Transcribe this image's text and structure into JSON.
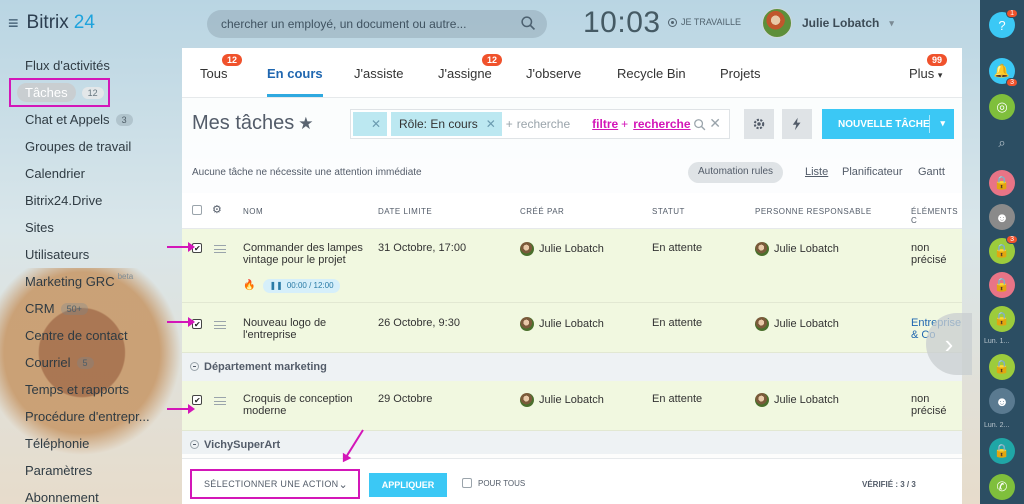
{
  "colors": {
    "accent": "#3bc8f5",
    "highlight": "#d316b8",
    "badge": "#f0522c",
    "row_bg": "#f1f8e0"
  },
  "header": {
    "brand": "Bitrix",
    "brand_num": "24",
    "search_placeholder": "chercher un employé, un document ou autre...",
    "clock": "10:03",
    "work_status": "JE TRAVAILLE",
    "user_name": "Julie Lobatch"
  },
  "sidebar": {
    "items": [
      {
        "label": "Flux d'activités"
      },
      {
        "label": "Tâches",
        "count": "12"
      },
      {
        "label": "Chat et Appels",
        "count": "3"
      },
      {
        "label": "Groupes de travail"
      },
      {
        "label": "Calendrier"
      },
      {
        "label": "Bitrix24.Drive"
      },
      {
        "label": "Sites"
      },
      {
        "label": "Utilisateurs"
      },
      {
        "label": "Marketing GRC",
        "beta": "beta"
      },
      {
        "label": "CRM",
        "count": "50+"
      },
      {
        "label": "Centre de contact"
      },
      {
        "label": "Courriel",
        "count": "5"
      },
      {
        "label": "Temps et rapports"
      },
      {
        "label": "Procédure d'entrepr..."
      },
      {
        "label": "Téléphonie"
      },
      {
        "label": "Paramètres"
      },
      {
        "label": "Abonnement"
      }
    ]
  },
  "tabs": [
    {
      "label": "Tous",
      "badge": "12"
    },
    {
      "label": "En cours"
    },
    {
      "label": "J'assiste"
    },
    {
      "label": "J'assigne",
      "badge": "12"
    },
    {
      "label": "J'observe"
    },
    {
      "label": "Recycle Bin"
    },
    {
      "label": "Projets"
    },
    {
      "label": "Plus",
      "badge": "99"
    }
  ],
  "toolbar": {
    "title": "Mes tâches",
    "filter_chip": "Rôle: En cours",
    "filter_placeholder": "recherche",
    "filter_link1": "filtre",
    "filter_link2": "recherche",
    "new_task": "NOUVELLE TÂCHE"
  },
  "subbar": {
    "attention": "Aucune tâche ne nécessite une attention immédiate",
    "automation": "Automation rules",
    "views": [
      "Liste",
      "Planificateur",
      "Gantt"
    ]
  },
  "grid": {
    "headers": [
      "NOM",
      "DATE LIMITE",
      "CRÉÉ PAR",
      "STATUT",
      "PERSONNE RESPONSABLE",
      "ÉLÉMENTS C"
    ],
    "rows": [
      {
        "name": "Commander des lampes vintage pour le projet",
        "deadline": "31 Octobre, 17:00",
        "creator": "Julie Lobatch",
        "status": "En attente",
        "responsible": "Julie Lobatch",
        "elements": "non précisé",
        "timer": "00:00 / 12:00"
      },
      {
        "name": "Nouveau logo de l'entreprise",
        "deadline": "26 Octobre, 9:30",
        "creator": "Julie Lobatch",
        "status": "En attente",
        "responsible": "Julie Lobatch",
        "elements": "Entreprise: & Co"
      },
      {
        "name": "Croquis de conception moderne",
        "deadline": "29 Octobre",
        "creator": "Julie Lobatch",
        "status": "En attente",
        "responsible": "Julie Lobatch",
        "elements": "non précisé"
      }
    ],
    "groups": [
      "Département marketing",
      "VichySuperArt"
    ]
  },
  "bottom": {
    "action_select": "SÉLECTIONNER UNE ACTION",
    "apply": "APPLIQUER",
    "for_all": "POUR TOUS",
    "verified": "VÉRIFIÉ : 3 / 3"
  },
  "rightbar": {
    "help_badge": "1",
    "notif_badge": "3",
    "chat_badge": "3",
    "time1": "Lun. 1...",
    "time2": "Lun. 2..."
  }
}
